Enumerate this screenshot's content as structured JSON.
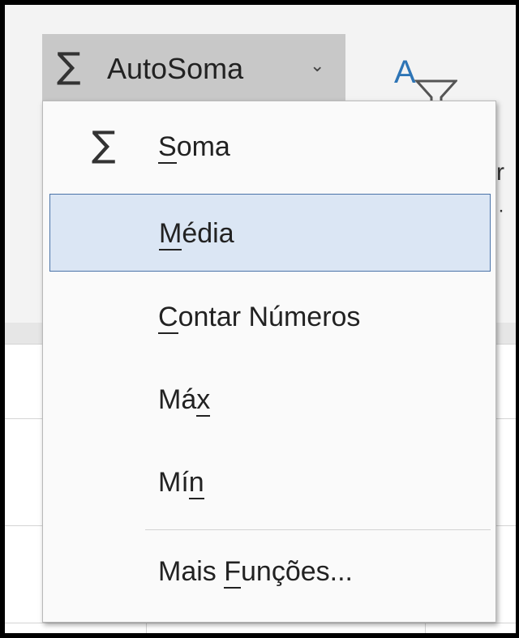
{
  "ribbon": {
    "autosum_icon": "sigma-icon",
    "autosum_symbol": "∑",
    "autosum_label": "AutoSoma",
    "autosum_chevron": "⌄",
    "sort_filter_icon": "sort-filter-icon",
    "sort_filter_letter": "A",
    "cut_text_r": "r",
    "cut_text_dot": "·"
  },
  "menu": {
    "items": [
      {
        "icon": "sigma-icon",
        "icon_symbol": "∑",
        "label_pre": "",
        "label_accel": "S",
        "label_post": "oma",
        "selected": false
      },
      {
        "icon": "",
        "icon_symbol": "",
        "label_pre": "",
        "label_accel": "M",
        "label_post": "édia",
        "selected": true
      },
      {
        "icon": "",
        "icon_symbol": "",
        "label_pre": "",
        "label_accel": "C",
        "label_post": "ontar Números",
        "selected": false
      },
      {
        "icon": "",
        "icon_symbol": "",
        "label_pre": "Má",
        "label_accel": "x",
        "label_post": "",
        "selected": false
      },
      {
        "icon": "",
        "icon_symbol": "",
        "label_pre": "Mí",
        "label_accel": "n",
        "label_post": "",
        "selected": false
      },
      {
        "icon": "",
        "icon_symbol": "",
        "label_pre": "Mais ",
        "label_accel": "F",
        "label_post": "unções...",
        "selected": false
      }
    ]
  },
  "colors": {
    "selected_bg": "#dbe6f4",
    "selected_border": "#4a73a8",
    "button_bg": "#c8c8c8",
    "accent_blue": "#2e75b6"
  }
}
